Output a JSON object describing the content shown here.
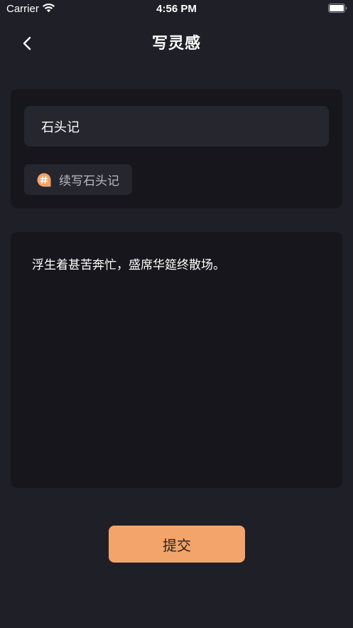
{
  "status_bar": {
    "carrier": "Carrier",
    "time": "4:56 PM"
  },
  "nav": {
    "title": "写灵感",
    "back_icon": "chevron-left-icon"
  },
  "title_field": {
    "value": "石头记"
  },
  "topic_chip": {
    "icon": "hashtag-bubble-icon",
    "label": "续写石头记"
  },
  "content": {
    "text": "浮生着甚苦奔忙，盛席华筵终散场。"
  },
  "submit": {
    "label": "提交"
  },
  "colors": {
    "background": "#1f1f28",
    "card": "#16161c",
    "input": "#26262f",
    "accent": "#f3a46a"
  }
}
